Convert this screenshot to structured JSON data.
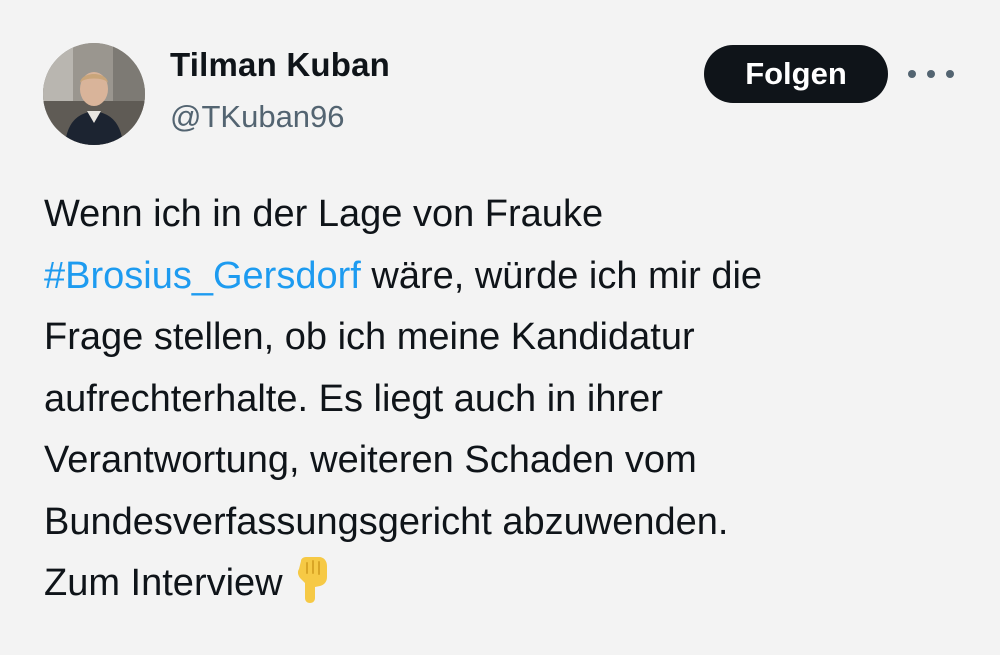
{
  "author": {
    "name": "Tilman Kuban",
    "handle": "@TKuban96"
  },
  "actions": {
    "follow_label": "Folgen",
    "more_icon": "more-horizontal-icon"
  },
  "tweet": {
    "line1": "Wenn ich in der Lage von Frauke",
    "hashtag": "#Brosius_Gersdorf",
    "line2_rest": " wäre, würde ich mir die",
    "line3": "Frage stellen, ob ich meine Kandidatur",
    "line4": "aufrechterhalte. Es liegt auch in ihrer",
    "line5": "Verantwortung, weiteren Schaden vom",
    "line6": "Bundesverfassungsgericht abzuwenden.",
    "line7": "Zum Interview",
    "emoji_icon": "pointing-down-hand-icon"
  },
  "colors": {
    "background": "#f3f3f3",
    "text": "#0f1419",
    "secondary_text": "#536471",
    "hashtag": "#1d9bf0",
    "button_bg": "#0f1419",
    "button_text": "#ffffff",
    "emoji": "#f6c945"
  }
}
